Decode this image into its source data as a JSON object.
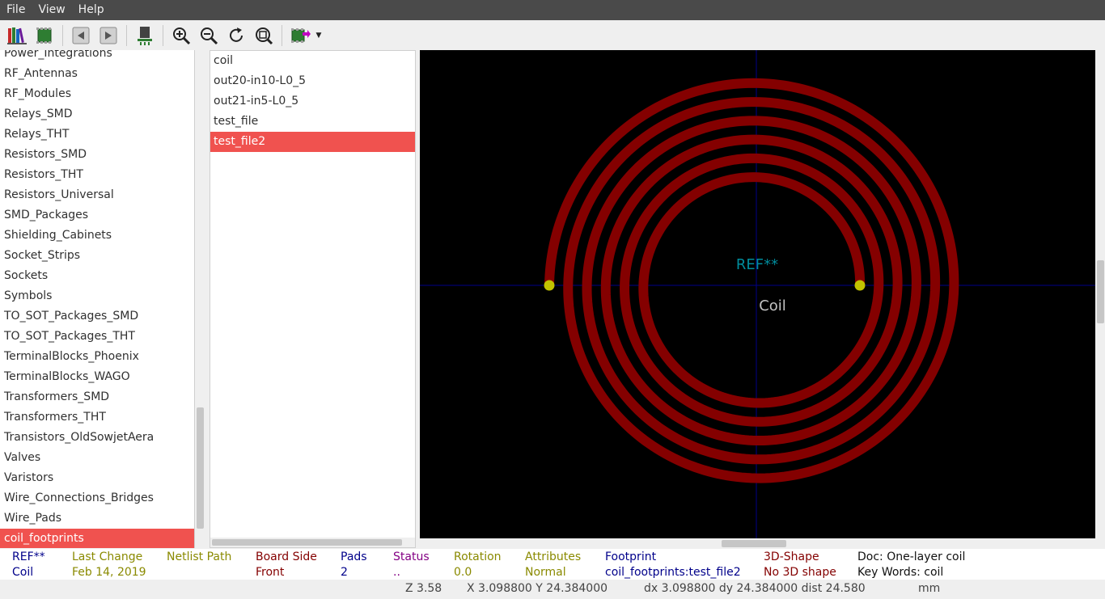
{
  "menu": [
    "File",
    "View",
    "Help"
  ],
  "toolbar": {
    "icons": [
      "library-browser-icon",
      "footprint-editor-icon",
      "previous-footprint-icon",
      "next-footprint-icon",
      "insert-footprint-icon",
      "zoom-in-icon",
      "zoom-out-icon",
      "redraw-icon",
      "zoom-fit-icon",
      "3d-viewer-icon"
    ]
  },
  "libraries": {
    "items": [
      "Power_Integrations",
      "RF_Antennas",
      "RF_Modules",
      "Relays_SMD",
      "Relays_THT",
      "Resistors_SMD",
      "Resistors_THT",
      "Resistors_Universal",
      "SMD_Packages",
      "Shielding_Cabinets",
      "Socket_Strips",
      "Sockets",
      "Symbols",
      "TO_SOT_Packages_SMD",
      "TO_SOT_Packages_THT",
      "TerminalBlocks_Phoenix",
      "TerminalBlocks_WAGO",
      "Transformers_SMD",
      "Transformers_THT",
      "Transistors_OldSowjetAera",
      "Valves",
      "Varistors",
      "Wire_Connections_Bridges",
      "Wire_Pads",
      "coil_footprints"
    ],
    "selected": "coil_footprints"
  },
  "footprints": {
    "items": [
      "coil",
      "out20-in10-L0_5",
      "out21-in5-L0_5",
      "test_file",
      "test_file2"
    ],
    "selected": "test_file2"
  },
  "canvas": {
    "ref_text": "REF**",
    "value_text": "Coil",
    "colors": {
      "background": "#000000",
      "copper": "#840000",
      "pad": "#c2c200",
      "ref": "#008c9c",
      "value": "#c2c2c2",
      "axis": "#00008a"
    }
  },
  "info": {
    "ref": {
      "label": "REF**",
      "value": "Coil"
    },
    "last_change": {
      "label": "Last Change",
      "value": "Feb 14, 2019"
    },
    "netlist_path": {
      "label": "Netlist Path",
      "value": ""
    },
    "board_side": {
      "label": "Board Side",
      "value": "Front"
    },
    "pads": {
      "label": "Pads",
      "value": "2"
    },
    "status": {
      "label": "Status",
      "value": ".."
    },
    "rotation": {
      "label": "Rotation",
      "value": "0.0"
    },
    "attributes": {
      "label": "Attributes",
      "value": "Normal"
    },
    "footprint": {
      "label": "Footprint",
      "value": "coil_footprints:test_file2"
    },
    "shape3d": {
      "label": "3D-Shape",
      "value": "No 3D shape"
    },
    "doc": "Doc: One-layer coil",
    "keywords": "Key Words: coil"
  },
  "status": {
    "zoom": "Z 3.58",
    "xy": "X 3.098800  Y 24.384000",
    "delta": "dx 3.098800  dy 24.384000  dist 24.580",
    "units": "mm"
  }
}
